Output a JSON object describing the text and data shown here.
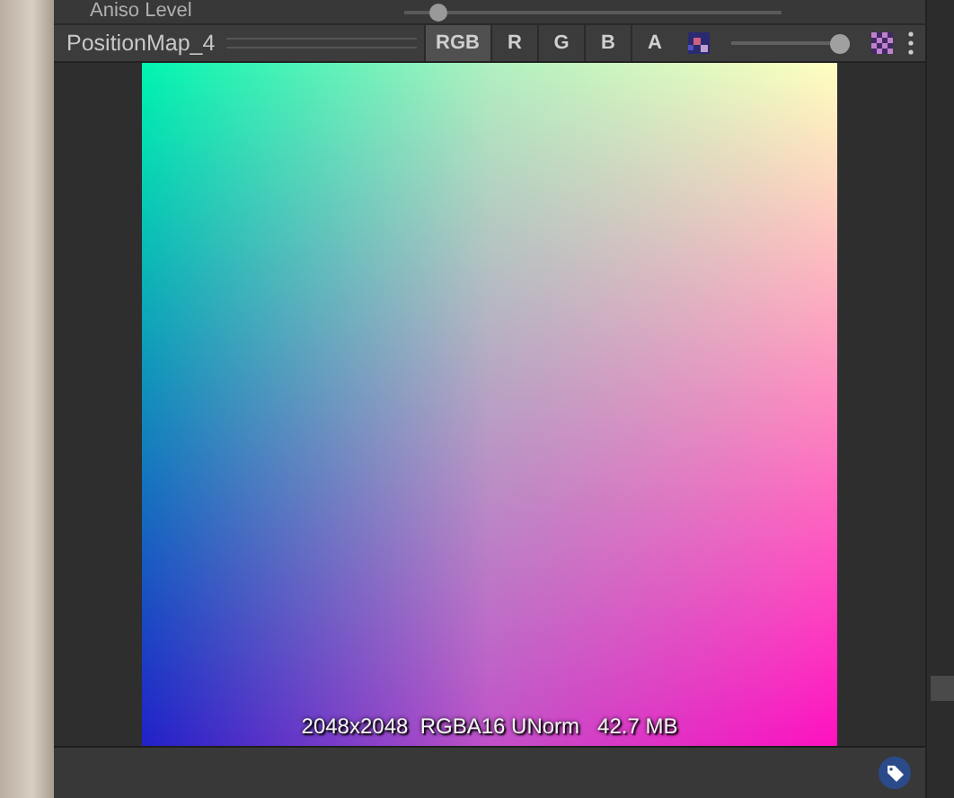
{
  "aniso_row": {
    "label": "Aniso Level",
    "level": 0.09
  },
  "preview": {
    "title": "PositionMap_4",
    "channels": [
      {
        "label": "RGB",
        "selected": true
      },
      {
        "label": "R",
        "selected": false
      },
      {
        "label": "G",
        "selected": false
      },
      {
        "label": "B",
        "selected": false
      },
      {
        "label": "A",
        "selected": false
      }
    ],
    "mip_slider": {
      "level": 1
    },
    "info": "2048x2048  RGBA16 UNorm   42.7 MB"
  }
}
